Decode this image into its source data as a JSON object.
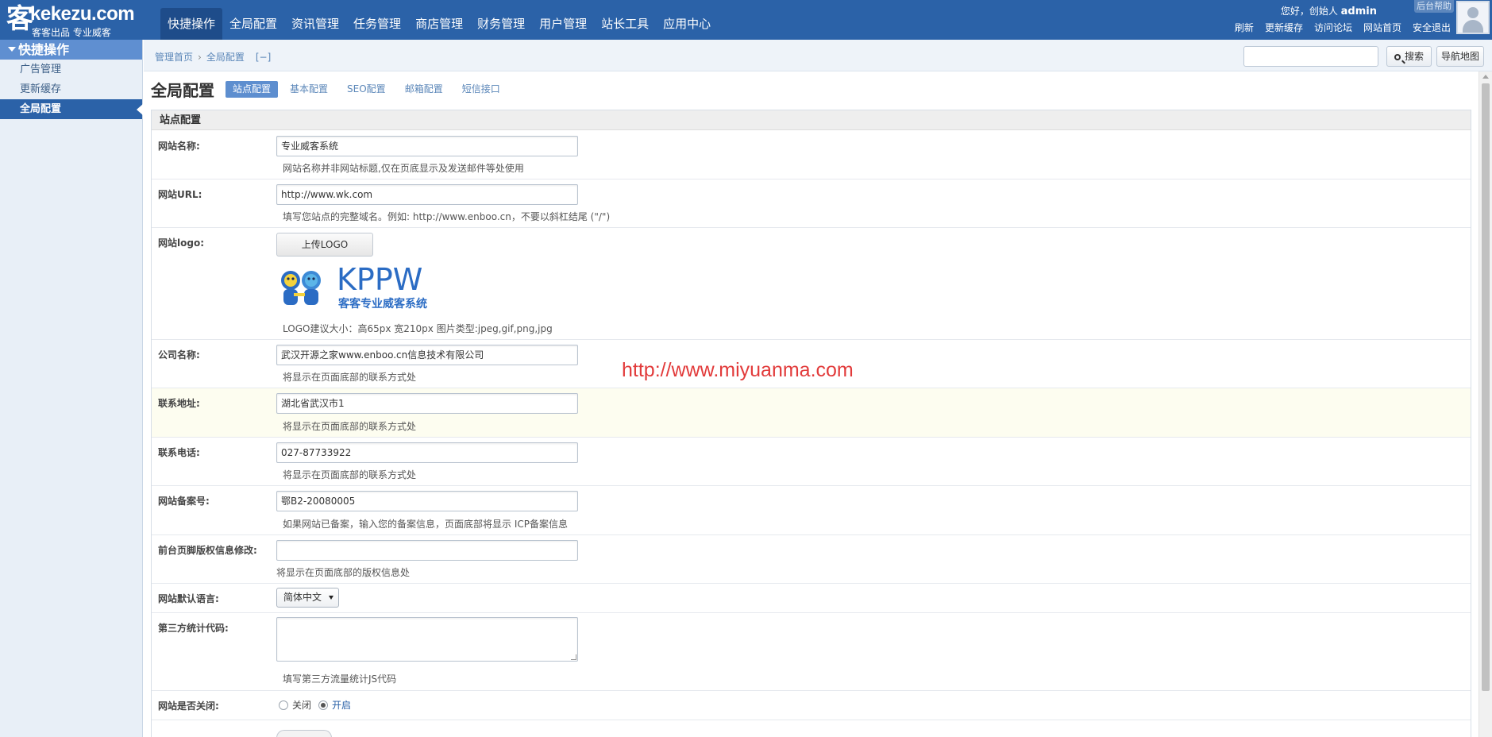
{
  "logo": {
    "main": "kekezu.com",
    "glyph": "客",
    "sub": "客客出品 专业威客"
  },
  "nav": [
    "快捷操作",
    "全局配置",
    "资讯管理",
    "任务管理",
    "商店管理",
    "财务管理",
    "用户管理",
    "站长工具",
    "应用中心"
  ],
  "user": {
    "greeting": "您好，创始人",
    "name": "admin",
    "help": "后台帮助"
  },
  "quick_links": [
    "刷新",
    "更新缓存",
    "访问论坛",
    "网站首页",
    "安全退出"
  ],
  "sidebar": {
    "title": "快捷操作",
    "items": [
      "广告管理",
      "更新缓存",
      "全局配置"
    ]
  },
  "breadcrumb": {
    "home": "管理首页",
    "current": "全局配置",
    "toggle": "[−]"
  },
  "toolbar": {
    "search_label": "搜索",
    "map_label": "导航地图"
  },
  "page": {
    "title": "全局配置",
    "tabs": [
      "站点配置",
      "基本配置",
      "SEO配置",
      "邮箱配置",
      "短信接口"
    ]
  },
  "panel": {
    "title": "站点配置"
  },
  "form": {
    "site_name": {
      "label": "网站名称:",
      "value": "专业威客系统",
      "hint": "网站名称并非网站标题,仅在页底显示及发送邮件等处使用"
    },
    "site_url": {
      "label": "网站URL:",
      "value": "http://www.wk.com",
      "hint": "填写您站点的完整域名。例如: http://www.enboo.cn，不要以斜杠结尾 (\"/\")"
    },
    "site_logo": {
      "label": "网站logo:",
      "button": "上传LOGO",
      "logo_title": "KPPW",
      "logo_sub": "客客专业威客系统",
      "hint": "LOGO建议大小：高65px 宽210px 图片类型:jpeg,gif,png,jpg"
    },
    "company": {
      "label": "公司名称:",
      "value": "武汉开源之家www.enboo.cn信息技术有限公司",
      "hint": "将显示在页面底部的联系方式处"
    },
    "address": {
      "label": "联系地址:",
      "value": "湖北省武汉市1",
      "hint": "将显示在页面底部的联系方式处"
    },
    "phone": {
      "label": "联系电话:",
      "value": "027-87733922",
      "hint": "将显示在页面底部的联系方式处"
    },
    "icp": {
      "label": "网站备案号:",
      "value": "鄂B2-20080005",
      "hint": "如果网站已备案，输入您的备案信息，页面底部将显示 ICP备案信息"
    },
    "copyright": {
      "label": "前台页脚版权信息修改:",
      "value": "",
      "hint": "将显示在页面底部的版权信息处"
    },
    "language": {
      "label": "网站默认语言:",
      "selected": "简体中文"
    },
    "stats_code": {
      "label": "第三方统计代码:",
      "hint": "填写第三方流量统计JS代码"
    },
    "site_closed": {
      "label": "网站是否关闭:",
      "option_off": "关闭",
      "option_on": "开启",
      "selected": "开启"
    }
  },
  "watermark": "http://www.miyuanma.com",
  "colors": {
    "header": "#2b62a8",
    "sidebar": "#e8eff7",
    "accent": "#5d8ecf",
    "watermark": "#e23b3b"
  }
}
